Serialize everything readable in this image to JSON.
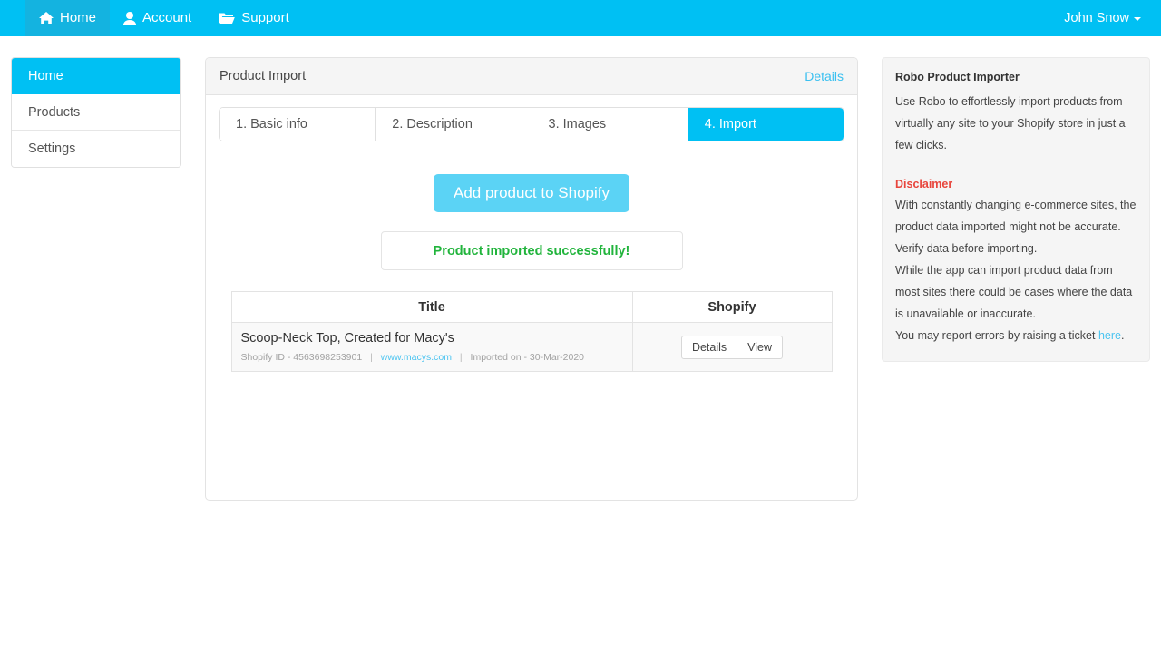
{
  "navbar": {
    "items": [
      {
        "label": "Home",
        "icon": "home-icon",
        "active": true
      },
      {
        "label": "Account",
        "icon": "user-icon",
        "active": false
      },
      {
        "label": "Support",
        "icon": "folder-icon",
        "active": false
      }
    ],
    "user": "John Snow",
    "bg_color": "#00c0f3",
    "active_bg_color": "#14b3e0"
  },
  "sidebar": {
    "items": [
      {
        "label": "Home"
      },
      {
        "label": "Products"
      },
      {
        "label": "Settings"
      }
    ]
  },
  "panel": {
    "title": "Product Import",
    "details_link": "Details",
    "steps": [
      {
        "label": "1. Basic info"
      },
      {
        "label": "2. Description"
      },
      {
        "label": "3. Images"
      },
      {
        "label": "4. Import"
      }
    ],
    "primary_button": "Add product to Shopify",
    "alert": {
      "text": "Product imported successfully!",
      "color": "#21b43c"
    },
    "table": {
      "headers": [
        "Title",
        "Shopify"
      ],
      "rows": [
        {
          "title": "Scoop-Neck Top, Created for Macy's",
          "shopify_id_label": "Shopify ID - 4563698253901",
          "source_link": "www.macys.com",
          "imported_on": "Imported on - 30-Mar-2020",
          "actions": [
            "Details",
            "View"
          ]
        }
      ]
    }
  },
  "info": {
    "title": "Robo Product Importer",
    "description": "Use Robo to effortlessly import products from virtually any site to your Shopify store in just a few clicks.",
    "disclaimer_title": "Disclaimer",
    "disclaimer_lines": [
      "With constantly changing e-commerce sites, the product data imported might not be accurate.",
      "Verify data before importing.",
      "While the app can import product data from most sites there could be cases where the data is unavailable or inaccurate."
    ],
    "report_prefix": "You may report errors by raising a ticket ",
    "report_link": "here",
    "report_suffix": ".",
    "disclaimer_color": "#e8453c"
  }
}
